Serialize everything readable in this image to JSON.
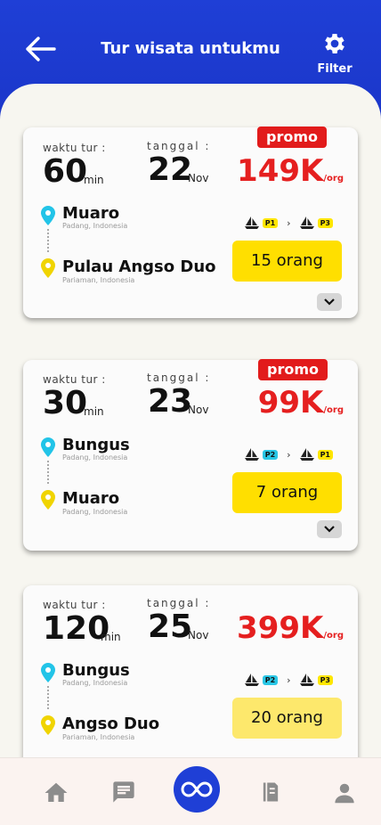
{
  "header": {
    "title": "Tur wisata untukmu",
    "filter_label": "Filter"
  },
  "labels": {
    "duration": "waktu tur :",
    "date": "tanggal :",
    "unit_min": "min",
    "per_org": "/org"
  },
  "tours": [
    {
      "duration": "60",
      "day": "22",
      "month": "Nov",
      "promo": "promo",
      "price": "149K",
      "from": {
        "name": "Muaro",
        "region": "Padang, Indonesia"
      },
      "to": {
        "name": "Pulau Angso Duo",
        "region": "Pariaman, Indonesia"
      },
      "route": [
        "P1",
        "P3"
      ],
      "pax": "15 orang"
    },
    {
      "duration": "30",
      "day": "23",
      "month": "Nov",
      "promo": "promo",
      "price": "99K",
      "from": {
        "name": "Bungus",
        "region": "Padang, Indonesia"
      },
      "to": {
        "name": "Muaro",
        "region": "Padang, Indonesia"
      },
      "route": [
        "P2",
        "P1"
      ],
      "pax": "7 orang"
    },
    {
      "duration": "120",
      "day": "25",
      "month": "Nov",
      "promo": "",
      "price": "399K",
      "from": {
        "name": "Bungus",
        "region": "Padang, Indonesia"
      },
      "to": {
        "name": "Angso Duo",
        "region": "Pariaman, Indonesia"
      },
      "route": [
        "P2",
        "P3"
      ],
      "pax": "20 orang"
    }
  ],
  "colors": {
    "brand": "#1f3fd6",
    "price": "#e51f1f",
    "promo_bg": "#e21b1b",
    "pax_bg": "#ffdf00",
    "pin_from": "#22c4e8",
    "pin_to": "#f0d400",
    "badge_P1": "#ffe600",
    "badge_P2": "#29c7e6",
    "badge_P3": "#ffe600"
  },
  "nav": {
    "items": [
      "home-icon",
      "chat-icon",
      "loop-icon",
      "ticket-icon",
      "profile-icon"
    ]
  }
}
